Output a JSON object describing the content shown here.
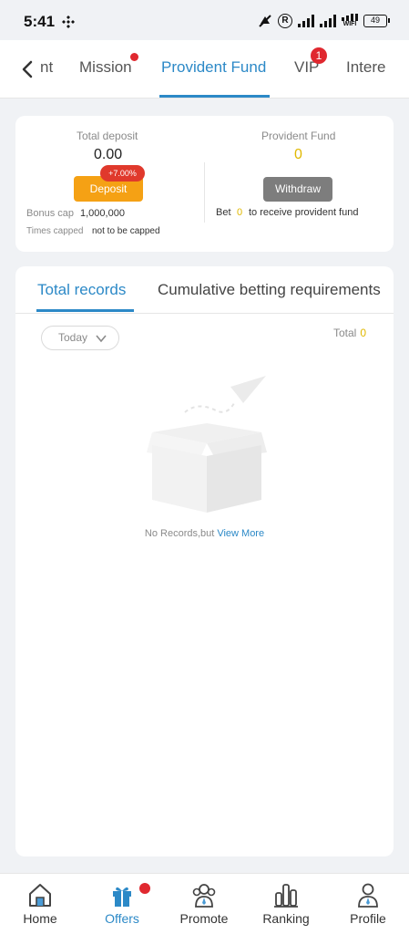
{
  "status_bar": {
    "time": "5:41",
    "battery": "49",
    "wifi": "WIFI"
  },
  "tabs": [
    {
      "label": "nt"
    },
    {
      "label": "Mission"
    },
    {
      "label": "Provident Fund"
    },
    {
      "label": "VIP",
      "badge": "1"
    },
    {
      "label": "Intere"
    }
  ],
  "fund": {
    "total_deposit_label": "Total deposit",
    "total_deposit_value": "0.00",
    "bonus_badge": "+7.00%",
    "deposit_button": "Deposit",
    "bonus_cap_label": "Bonus cap",
    "bonus_cap_value": "1,000,000",
    "times_capped_label": "Times capped",
    "times_capped_value": "not to be capped",
    "provident_fund_label": "Provident Fund",
    "provident_fund_value": "0",
    "withdraw_button": "Withdraw",
    "bet_label": "Bet",
    "bet_value": "0",
    "bet_suffix": "to receive provident fund"
  },
  "records": {
    "tabs": [
      {
        "label": "Total records"
      },
      {
        "label": "Cumulative betting requirements"
      }
    ],
    "filter_value": "Today",
    "total_label": "Total",
    "total_value": "0",
    "empty_text": "No Records,but",
    "view_more": "View More"
  },
  "bottom_nav": [
    {
      "label": "Home"
    },
    {
      "label": "Offers"
    },
    {
      "label": "Promote"
    },
    {
      "label": "Ranking"
    },
    {
      "label": "Profile"
    }
  ],
  "colors": {
    "accent": "#2c89c7",
    "deposit": "#f5a114",
    "badge": "#e0282f",
    "withdraw": "#7d7d7d",
    "highlight": "#e0b800"
  }
}
